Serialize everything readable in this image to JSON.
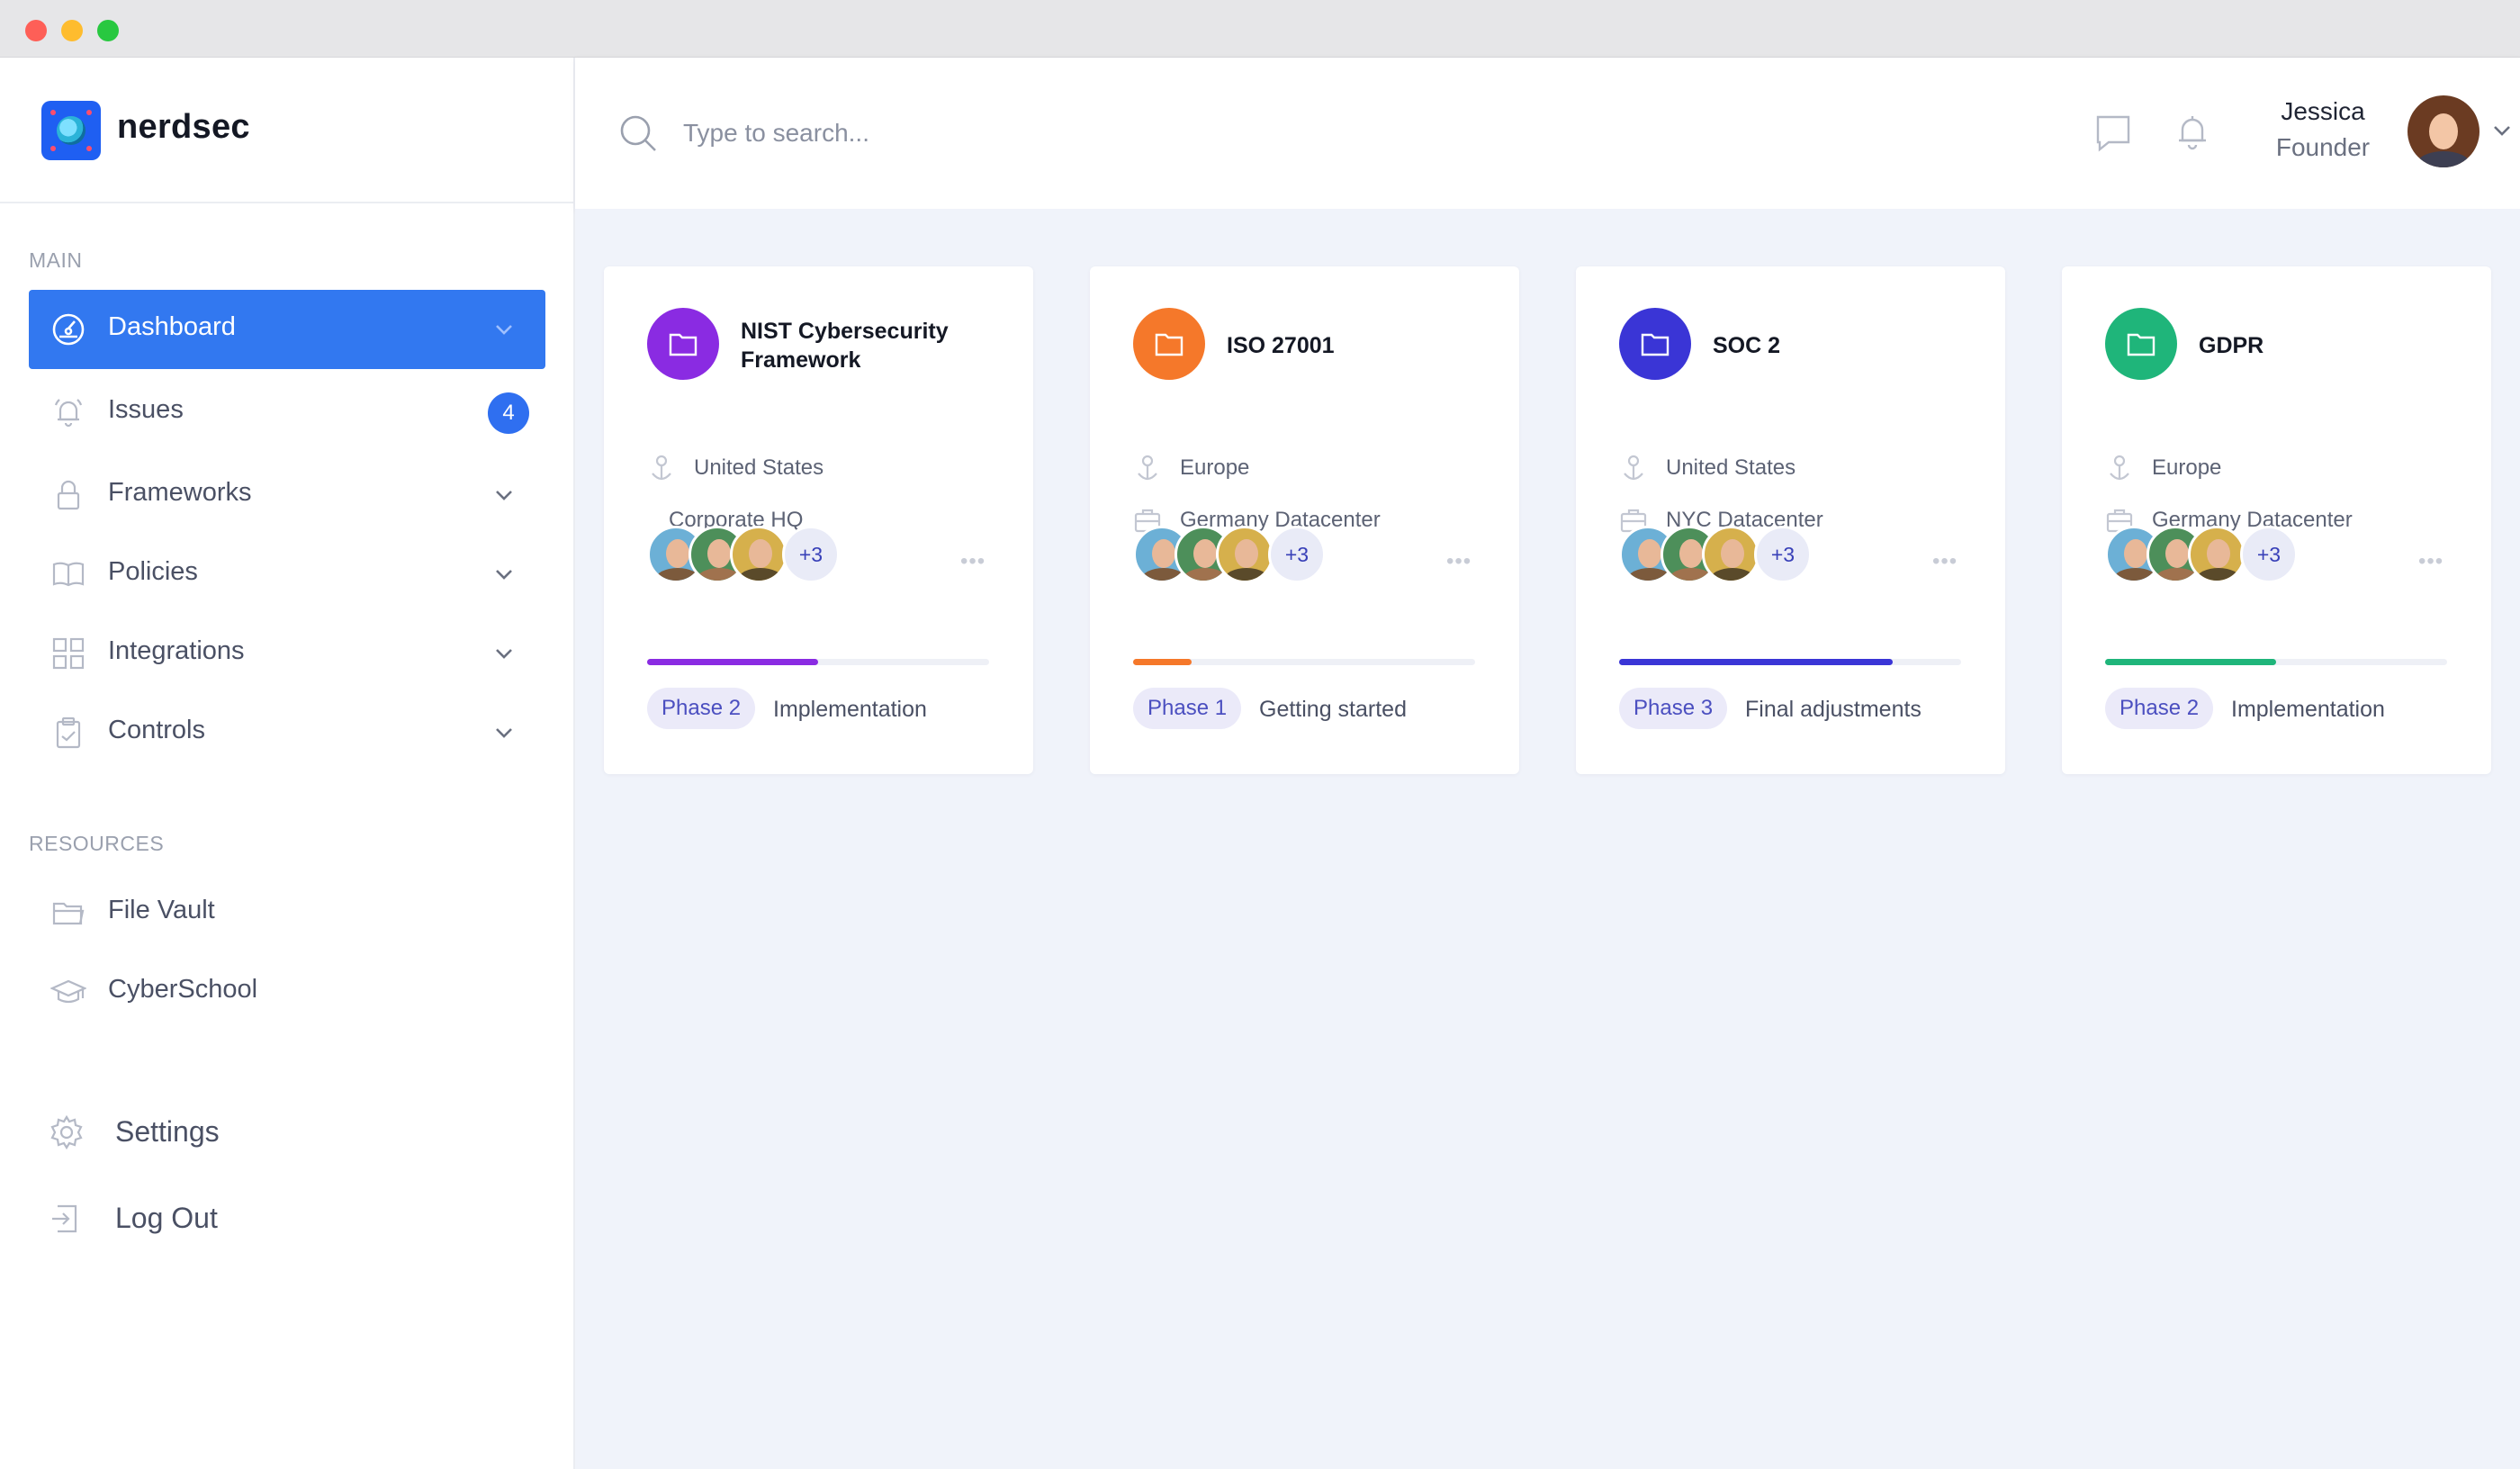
{
  "brand": {
    "name": "nerdsec"
  },
  "sidebar": {
    "main_label": "MAIN",
    "resources_label": "RESOURCES",
    "items": [
      {
        "label": "Dashboard",
        "icon": "dashboard-gauge-icon",
        "active": true
      },
      {
        "label": "Issues",
        "icon": "bell-icon",
        "badge": "4"
      },
      {
        "label": "Frameworks",
        "icon": "lock-icon"
      },
      {
        "label": "Policies",
        "icon": "book-icon"
      },
      {
        "label": "Integrations",
        "icon": "grid-icon"
      },
      {
        "label": "Controls",
        "icon": "clipboard-icon"
      }
    ],
    "resources": [
      {
        "label": "File Vault",
        "icon": "folder-icon"
      },
      {
        "label": "CyberSchool",
        "icon": "graduation-cap-icon"
      }
    ],
    "bottom": [
      {
        "label": "Settings",
        "icon": "gear-icon"
      },
      {
        "label": "Log Out",
        "icon": "logout-icon"
      }
    ]
  },
  "header": {
    "search_placeholder": "Type to search...",
    "user": {
      "name": "Jessica",
      "role": "Founder"
    }
  },
  "cards": [
    {
      "title": "NIST Cybersecurity Framework",
      "color": "#8a2be2",
      "region": "United States",
      "site": "Corporate HQ",
      "site_icon": false,
      "more_members": "+3",
      "progress": 0.5,
      "progress_color": "#8a2be2",
      "phase": "Phase 2",
      "stage": "Implementation"
    },
    {
      "title": "ISO 27001",
      "color": "#f5782a",
      "region": "Europe",
      "site": "Germany Datacenter",
      "site_icon": true,
      "more_members": "+3",
      "progress": 0.17,
      "progress_color": "#f5782a",
      "phase": "Phase 1",
      "stage": "Getting started"
    },
    {
      "title": "SOC 2",
      "color": "#3a35d6",
      "region": "United States",
      "site": "NYC Datacenter",
      "site_icon": true,
      "more_members": "+3",
      "progress": 0.8,
      "progress_color": "#3a35d6",
      "phase": "Phase 3",
      "stage": "Final adjustments"
    },
    {
      "title": "GDPR",
      "color": "#1fb57a",
      "region": "Europe",
      "site": "Germany Datacenter",
      "site_icon": true,
      "more_members": "+3",
      "progress": 0.5,
      "progress_color": "#1fb57a",
      "phase": "Phase 2",
      "stage": "Implementation"
    }
  ]
}
